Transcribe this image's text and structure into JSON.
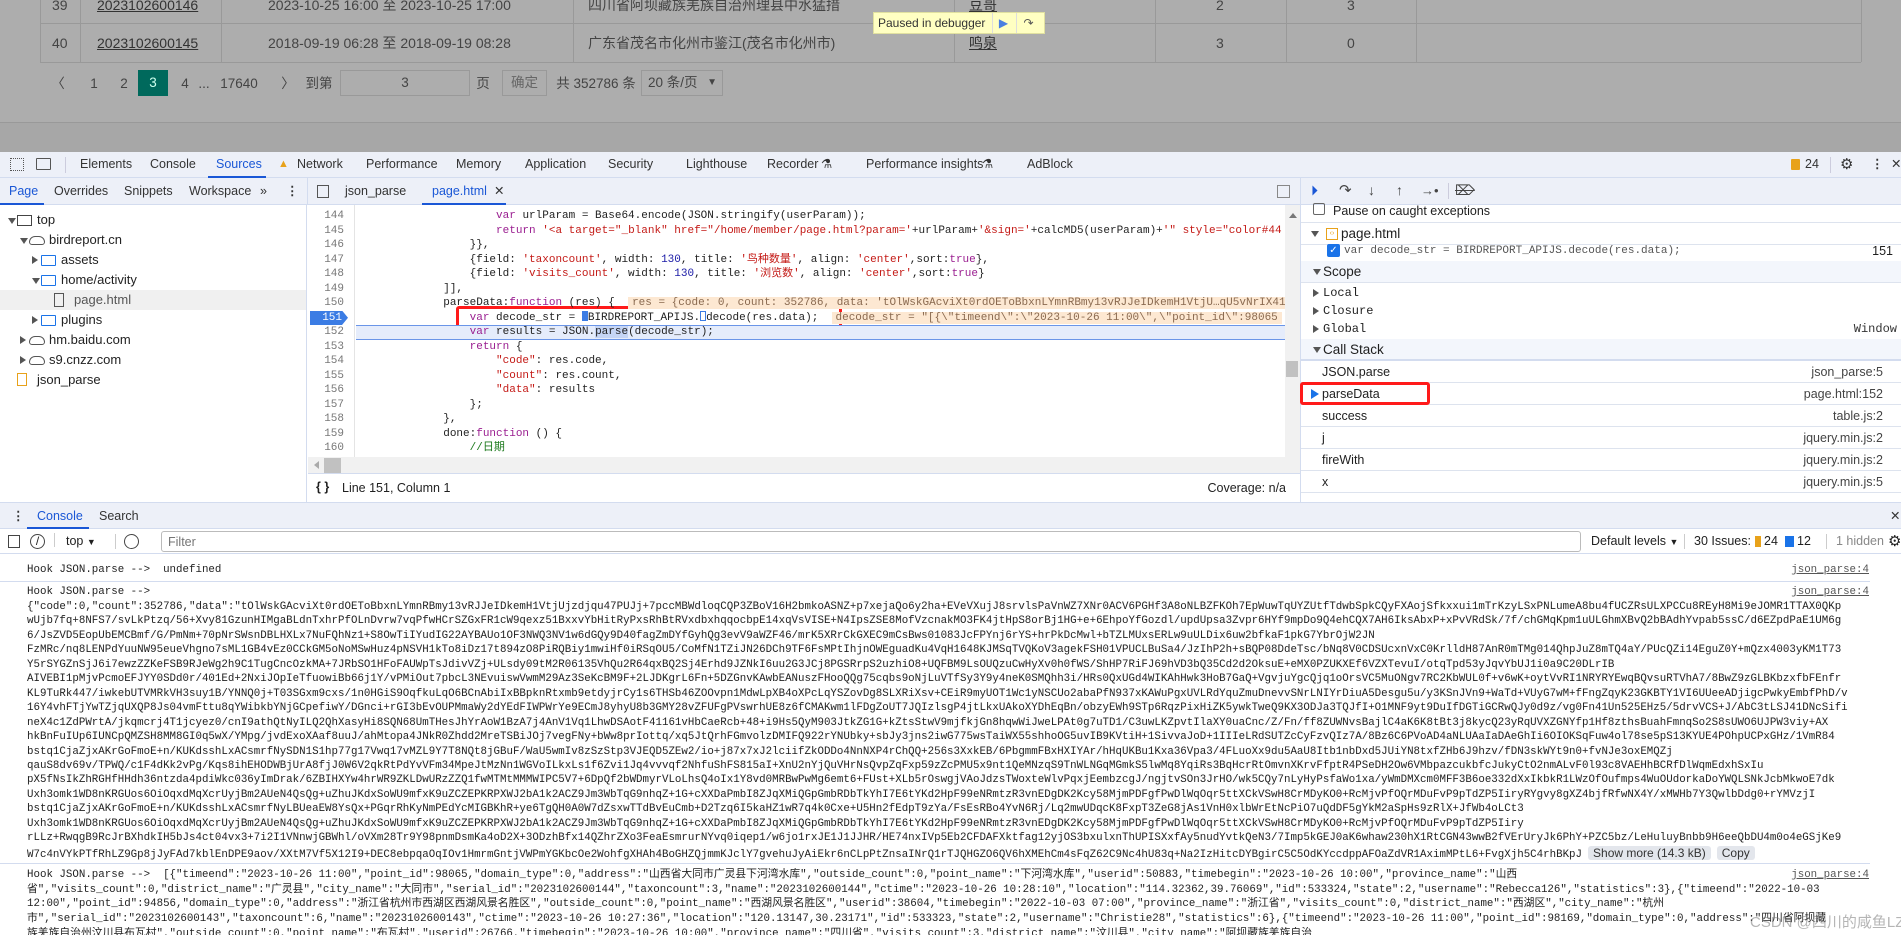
{
  "page": {
    "rows": [
      {
        "index": "39",
        "serial": "2023102600146",
        "time": "2023-10-25 16:00 至 2023-10-25 17:00",
        "address": "四川省阿坝藏族羌族自治州理县中水猛措",
        "user": "豆哥",
        "taxon": "2",
        "visits": "3"
      },
      {
        "index": "40",
        "serial": "2023102600145",
        "time": "2018-09-19 06:28 至 2018-09-19 08:28",
        "address": "广东省茂名市化州市鉴江(茂名市化州市)",
        "user": "鸣泉",
        "taxon": "3",
        "visits": "0"
      }
    ],
    "pager": {
      "prev": "〈",
      "pages": [
        "1",
        "2",
        "3",
        "4"
      ],
      "active": "3",
      "ellipsis": "...",
      "last": "17640",
      "next": "〉",
      "goto_label": "到第",
      "goto_value": "3",
      "page_unit": "页",
      "confirm": "确定",
      "total": "共 352786 条",
      "page_size": "20 条/页",
      "accent": "#00695c"
    },
    "paused_label": "Paused in debugger"
  },
  "devtools": {
    "tabs": [
      "Elements",
      "Console",
      "Sources",
      "Network",
      "Performance",
      "Memory",
      "Application",
      "Security",
      "Lighthouse",
      "Recorder",
      "Performance insights",
      "AdBlock"
    ],
    "active_tab": "Sources",
    "issues_count": "24",
    "sources_subtabs": [
      "Page",
      "Overrides",
      "Snippets",
      "Workspace"
    ],
    "editor_tabs": [
      "json_parse",
      "page.html"
    ],
    "navigator": [
      {
        "label": "top",
        "icon": "frame-icon",
        "level": 0,
        "expanded": true
      },
      {
        "label": "birdreport.cn",
        "icon": "cloud-icon",
        "level": 1,
        "expanded": true
      },
      {
        "label": "assets",
        "icon": "folder-icon",
        "level": 2,
        "expanded": false
      },
      {
        "label": "home/activity",
        "icon": "folder-icon",
        "level": 2,
        "expanded": true
      },
      {
        "label": "page.html",
        "icon": "file-icon",
        "level": 3,
        "selected": true
      },
      {
        "label": "plugins",
        "icon": "folder-icon",
        "level": 2,
        "expanded": false
      },
      {
        "label": "hm.baidu.com",
        "icon": "cloud-icon",
        "level": 1,
        "expanded": false
      },
      {
        "label": "s9.cnzz.com",
        "icon": "cloud-icon",
        "level": 1,
        "expanded": false
      },
      {
        "label": "json_parse",
        "icon": "snippet-icon",
        "level": 0
      }
    ],
    "code": {
      "current_line": "152",
      "breakpoint_line": "151",
      "lines": [
        {
          "n": "144",
          "tokens": [
            [
              "                    ",
              "plain"
            ],
            [
              "var",
              "kw"
            ],
            [
              " urlParam = Base64.encode(JSON.stringify(userParam));",
              "plain"
            ]
          ]
        },
        {
          "n": "145",
          "tokens": [
            [
              "                    ",
              "plain"
            ],
            [
              "return",
              "kw"
            ],
            [
              " ",
              "plain"
            ],
            [
              "'<a target=\"_blank\" href=\"/home/member/page.html?param='",
              "str"
            ],
            [
              "+urlParam+",
              "plain"
            ],
            [
              "'&sign='",
              "str"
            ],
            [
              "+calcMD5(userParam)+",
              "plain"
            ],
            [
              "'\" style=\"color#44",
              "str"
            ]
          ]
        },
        {
          "n": "146",
          "tokens": [
            [
              "                }},",
              "plain"
            ]
          ]
        },
        {
          "n": "147",
          "tokens": [
            [
              "                {field: ",
              "plain"
            ],
            [
              "'taxoncount'",
              "str"
            ],
            [
              ", width: ",
              "plain"
            ],
            [
              "130",
              "num"
            ],
            [
              ", title: ",
              "plain"
            ],
            [
              "'鸟种数量'",
              "str"
            ],
            [
              ", align: ",
              "plain"
            ],
            [
              "'center'",
              "str"
            ],
            [
              ",sort:",
              "plain"
            ],
            [
              "true",
              "kw"
            ],
            [
              "},",
              "plain"
            ]
          ]
        },
        {
          "n": "148",
          "tokens": [
            [
              "                {field: ",
              "plain"
            ],
            [
              "'visits_count'",
              "str"
            ],
            [
              ", width: ",
              "plain"
            ],
            [
              "130",
              "num"
            ],
            [
              ", title: ",
              "plain"
            ],
            [
              "'浏览数'",
              "str"
            ],
            [
              ", align: ",
              "plain"
            ],
            [
              "'center'",
              "str"
            ],
            [
              ",sort:",
              "plain"
            ],
            [
              "true",
              "kw"
            ],
            [
              "}",
              "plain"
            ]
          ]
        },
        {
          "n": "149",
          "tokens": [
            [
              "            ]],",
              "plain"
            ]
          ]
        },
        {
          "n": "150",
          "tokens": [
            [
              "            parseData:",
              "plain"
            ],
            [
              "function",
              "kw"
            ],
            [
              " (res) {  ",
              "plain"
            ]
          ],
          "inline": "res = {code: 0, count: 352786, data: 'tOlWskGAcviXt0rdOEToBbxnLYmnRBmy13vRJJeIDkemH1VtjU…qU5vNrIX41"
        },
        {
          "n": "151",
          "tokens": [
            [
              "                ",
              "plain"
            ],
            [
              "var",
              "kw"
            ],
            [
              " decode_str = ",
              "plain"
            ],
            [
              "▶",
              "plain"
            ],
            [
              "BIRDREPORT_APIJS.",
              "plain"
            ],
            [
              "▷",
              "plain"
            ],
            [
              "decode(res.data);  ",
              "plain"
            ]
          ],
          "inline": "decode_str = \"[{\\\"timeend\\\":\\\"2023-10-26 11:00\\\",\\\"point_id\\\":98065"
        },
        {
          "n": "152",
          "tokens": [
            [
              "                ",
              "plain"
            ],
            [
              "var",
              "kw"
            ],
            [
              " results = JSON.",
              "plain"
            ],
            [
              "parse",
              "plain"
            ],
            [
              "(decode_str);",
              "plain"
            ]
          ]
        },
        {
          "n": "153",
          "tokens": [
            [
              "                ",
              "plain"
            ],
            [
              "return",
              "kw"
            ],
            [
              " {",
              "plain"
            ]
          ]
        },
        {
          "n": "154",
          "tokens": [
            [
              "                    ",
              "plain"
            ],
            [
              "\"code\"",
              "str"
            ],
            [
              ": res.code,",
              "plain"
            ]
          ]
        },
        {
          "n": "155",
          "tokens": [
            [
              "                    ",
              "plain"
            ],
            [
              "\"count\"",
              "str"
            ],
            [
              ": res.count,",
              "plain"
            ]
          ]
        },
        {
          "n": "156",
          "tokens": [
            [
              "                    ",
              "plain"
            ],
            [
              "\"data\"",
              "str"
            ],
            [
              ": results",
              "plain"
            ]
          ]
        },
        {
          "n": "157",
          "tokens": [
            [
              "                };",
              "plain"
            ]
          ]
        },
        {
          "n": "158",
          "tokens": [
            [
              "            },",
              "plain"
            ]
          ]
        },
        {
          "n": "159",
          "tokens": [
            [
              "            done:",
              "plain"
            ],
            [
              "function",
              "kw"
            ],
            [
              " () {",
              "plain"
            ]
          ]
        },
        {
          "n": "160",
          "tokens": [
            [
              "                ",
              "plain"
            ],
            [
              "//日期",
              "cmt"
            ]
          ]
        }
      ]
    },
    "status": {
      "position": "Line 151, Column 1",
      "coverage": "Coverage: n/a"
    },
    "debugger": {
      "pause_caught": "Pause on caught exceptions",
      "bp_file": "page.html",
      "bp_code": "var decode_str = BIRDREPORT_APIJS.decode(res.data);",
      "bp_line": "151",
      "scope_label": "Scope",
      "scope": [
        "Local",
        "Closure",
        "Global"
      ],
      "global_value": "Window",
      "callstack_label": "Call Stack",
      "callstack": [
        {
          "fn": "JSON.parse",
          "loc": "json_parse:5"
        },
        {
          "fn": "parseData",
          "loc": "page.html:152",
          "current": true
        },
        {
          "fn": "success",
          "loc": "table.js:2"
        },
        {
          "fn": "j",
          "loc": "jquery.min.js:2"
        },
        {
          "fn": "fireWith",
          "loc": "jquery.min.js:2"
        },
        {
          "fn": "x",
          "loc": "jquery.min.js:5"
        }
      ]
    },
    "drawer_tabs": [
      "Console",
      "Search"
    ],
    "console": {
      "context": "top",
      "filter_placeholder": "Filter",
      "levels": "Default levels",
      "issues_label": "30 Issues:",
      "issues_warn": "24",
      "issues_info": "12",
      "hidden": "1 hidden",
      "messages": [
        {
          "text": "Hook JSON.parse -->  undefined",
          "source": "json_parse:4"
        },
        {
          "text": "Hook JSON.parse -->",
          "source": "json_parse:4"
        }
      ],
      "blob_lines": [
        "{\"code\":0,\"count\":352786,\"data\":\"tOlWskGAcviXt0rdOEToBbxnLYmnRBmy13vRJJeIDkemH1VtjUjzdjqu47PUJj+7pccMBWdloqCQP3ZBoV16H2bmkoASNZ+p7xejaQo6y2ha+EVeVXujJ8srvlsPaVnWZ7XNr0ACV6PGHf3A8oNLBZFKOh7EpWuwTqUYZUtfTdwbSpkCQyFXAojSfkxxui1mTrKzyLSxPNLumeA8bu4fUCZRsULXPCCu8REyH8Mi9eJOMR1TTAX0QKp",
        "wUjb7fq+8NFS7/svLkPtzq/56+Xvy81GzunHIMgaBLdnTxhrPfOLnDvrw7vqPfwHCrSZGxFR1cW9qexz51BxxvYbHitRyPxsRhBtRVxdbxhqqocbpE14xqVsVISE+N4IpsZSE8MofVzcnakMO3FK4jtHpS8orBj1HG+e+6EhpoYfGozdl/updUpsa3Zvpr6HYf9mpDo9Q4ehCQX7AH6IksAbxP+xPvVRdSk/7f/chGMqKpm1uULGhmXBvQ2bBAdhYvpab5ssC/d6EZpdPaE1UM6g",
        "6/JsZVD5EopUbEMCBmf/G/PmNm+70pNrSWsnDBLHXLx7NuFQhNz1+S8OwTiIYudIG22AYBAUo1OF3NWQ3NV1w6dGQy9D40fagZmDYfGyhQg3evV9aWZF46/mrK5XRrCkGXEC9mCsBws01083JcFPYnj6rYS+hrPkDcMwl+bTZLMUxsERLw9uULDix6uw2bfkaF1pkG7YbrOjW2JN",
        "FzMRc/nq8LENPdYuuNW95eueVhgno7sML1GB4vEz0CCkGM5oNoMSwHuz4pNSVH1kTo8iDz17t894zO8PiRQBiy1mwiHf0iRSqOU5/CoMfN1TZiJN26DCh9TF6FsMPtIhjnOWEguadKu4VqH1648KJMSqTVQKoV3agekFSH01VPUCLBuSa4/JzIhP2h+sBQP08DdeTsc/bNq8V0CDSUcxnVxC0KrlldH87AnR0mTMg014QhpJuZ8mTQ4aY/PUcQZi14EguZ0Y+mQzx4003yKM1T73",
        "Y5rSYGZnSjJ6i7ewzZZKeFSB9RJeWg2h9C1TugCncOzkMA+7JRbSO1HFoFAUWpTsJdivVZj+ULsdy09tM2R06135VhQu2R64qxBQ2Sj4Erhd9JZNkI6uu2G3JCj8PGSRrpS2uzhiO8+UQFBM9LsOUQzuCwHyXv0h0fWS/ShHP7RiFJ69hVD3bQ35Cd2d2OksuE+eMX0PZUKXEf6VZXTevuI/otqTpd53yJqvYbUJ1i0a9C20DLrIB",
        "AIVEBI1pMjvPcmoEFJYY0SDd0r/401Ed+2NxiJOpIeTfuowiBb66j1Y/vPMiOut7pbcL3NEvuiswVwmM29Az3SeKcBM9F+2LJDKgrL6Fn+5DZGnvKAwbEANuszFHooQQg75cqbs9oNjLuVTfSy3Y9y4neK0SMQhh3i/HRs0QxUGd4WIKAhHwk3HoB7GaQ+VgvjuYgcQjq1oOrsVC5MuONgv7RC2KbWUL0f+v6wK+oytVvRI1NRYRYEwqBQvsuRTVhA7/8BwZ9zGLBKbzxfbFEnfr",
        "KL9TuRk447/iwkebUTVMRkVH3suy1B/YNNQ0j+T03SGxm9cxs/1n0HGiS9OqfkuLqO6BCnAbiIxBBpknRtxmb9etdyjrCy1s6THSb46ZOOvpn1MdwLpXB4oXPcLqYSZovDg8SLXRiXsv+CEiR9myUOT1Wc1yNSCUo2abaPfN937xKAWuPgxUVLRdYquZmuDnevvSNrLNIYrDiuA5Desgu5u/y3KSnJVn9+WaTd+VUyG7wM+fFngZqyK23GKBTY1VI6UUeeADjigcPwkyEmbfPhD/v",
        "16Y4vhFTjYwTZjqUXQP8Js04vmFttu8qYWibkbYNjGCpefiwY/DGnci+rGI3bEvOUPMmaWy2dYEdFIWPWrYe9ECmJ8yhyU8b3GMY28vZFUFgPVswrhUE8z6fCMAKwm1lFDgZoUT7JQIzlsgP4jtLkxUAkoXYDhEqBn/obzyEWh9STp6RqzPixHiZK5ywkTweQ9KX3ODJa3TQJfI+O1MNF9yt9DuIfDGTiGCRwQJy0d9z/vg0Fn41Un525EHz5/5drvVCS+J/AbC3tLSJ41DNcSifi",
        "neX4c1ZdPWrtA/jkqmcrj4T1jcyez0/cnI9athQtNyILQ2QhXasyHi8SQN68UmTHesJhYrAoW1BzA7j4AnV1Vq1LhwDSAotF41161vHbCaeRcb+48+i9Hs5QyM903JtkZG1G+kZtsStwV9mjfkjGn8hqwWiJweLPAt0g7uTD1/C3uwLKZpvtIlaXY0uaCnc/Z/Fn/ff8ZUWNvsBajlC4aK6K8tBt3j8kycQ23yRqUVXZGNYfp1Hf8zthsBuahFmnqSo2S8sUWO6UJPW3viy+AX",
        "hkBnFuIUp6IUNCpQMZSH8MM8GI0q5wX/YMpg/jvdExoXAaf8uuJ/ahMtopa4JNkR0Zhdd2MreTSBiJOj7vegFNy+bWw8prIottq/xq5JtQrhFGmvolzDMIFQ922rYNUbky+sbJy3jns2iwG775wsTaiWX55shhoOG5uvIB9KVtiH+1SivvaJoD+1IIIeLRdSUTZcCyFzvQIz7A/8Bz6C6PVoAD4aNLUAaIaDAeGhIi6OIOKSqFuw4ol78se5pS13KYUE4POhpUCPxGHz/1VmR84",
        "bstq1CjaZjxAKrGoFmoE+n/KUKdsshLxACsmrfNySDN1S1hp77g17Vwq17vMZL9Y7T8NQt8jGBuF/WaU5wmIv8zSzStp3VJEQD5ZEw2/io+j87x7xJ2lciifZkODDo4NnNXP4rChQQ+256s3XxkEB/6PbgmmFBxHXIYAr/hHqUKBu1Kxa36Vpa3/4FLuoXx9du5AaU8Itb1nbDxd5JUiYN8txfZHb6J9hzv/fDN3skWYt9n0+fvNJe3oxEMQZj",
        "qauS8dv69v/TPWQ/c1F4dKk2vPg/Kqs8ihEHODWBjUrA8fjJ0W6V2qkRtPdYvVFm34MpeJtMzNn1WGVoILkxLs1f6Zvi1Jq4vvvqf2NhfuShFS815aI+XnU2nYjQuVHrNsQvpZqFxp59zZcPMU5x9nt1QeMNzqS9TnWLNGqMGmkS5lwMq8YqiRs3BqHcrRtOmvnXKrvFfptR4PSeDH2Ow6VMbpazcukbfcJukyCtO2nmALvF0l93c8VAEHhBCRfDlWqmEdxhSxIu",
        "pX5fNsIkZhRGHfHHdh36ntzda4pdiWkc036yImDrak/6ZBIHXYw4hrWR9ZKLDwURzZZQ1fwMTMtMMMWIPC5V7+6DpQf2bWDmyrVLoLhsQ4oIx1Y8vd0MRBwPwMg6emt6+FUst+XLb5rOswgjVAoJdzsTWoxteWlvPqxjEembzcgJ/ngjtvSOn3JrHO/wk5CQy7nLyHyPsfaWo1xa/yWmDMXcm0MFF3B6oe332dXxIkbkR1LWzOfOufmps4WuOUdorkaDoYWQLSNkJcbMkwoE7dk",
        "Uxh3omk1WD8nKRGUos6OiOqxdMqXcrUyjBm2AUeN4QsQg+uZhuJKdxSoWU9mfxK9uZCZEPKRPXWJ2bA1k2ACZ9Jm3WbTqG9nhqZ+1G+cXXDaPmbI8ZJqXMiQGpGmbRDbTkYhI7E6tYKd2HpF99eNRmtzR3vnEDgDK2Kcy58MjmPDFgfPwDlWqOqr5ttXCkVSwH8CrMDyKO0+RcMjvPfOQrMDuFvP9pTdZP5IiryRYgvy8gXZ4bjfRfwNX4Y/xMWHb7Y3QwlbDdg0+rYMVzjI",
        "bstq1CjaZjxAKrGoFmoE+n/KUKdsshLxACsmrfNyLBUeaEW8YsQx+PGqrRhKyNmPEdYcMIGBKhR+ye6TgQH0A0W7dZsxwTTdBvEuCmb+D2Tzq6I5kaHZ1wR7q4k0Cxe+U5Hn2fEdpT9zYa/FsEsRBo4YvN6Rj/Lq2mwUDqcK8FxpT3ZeG8jAs1VnH0xlbWrEtNcPiO7uQdDF5gYkM2aSpHs9zRlX+JfWb4oLCt3",
        "Uxh3omk1WD8nKRGUos6OiOqxdMqXcrUyjBm2AUeN4QsQg+uZhuJKdxSoWU9mfxK9uZCZEPKRPXWJ2bA1k2ACZ9Jm3WbTqG9nhqZ+1G+cXXDaPmbI8ZJqXMiQGpGmbRDbTkYhI7E6tYKd2HpF99eNRmtzR3vnEDgDK2Kcy58MjmPDFgfPwDlWqOqr5ttXCkVSwH8CrMDyKO0+RcMjvPfOQrMDuFvP9pTdZP5Iiry",
        "rLLz+RwqgB9RcJrBXhdkIH5bJs4ct04vx3+7i2I1VNnwjGBWhl/oVXm28Tr9Y98pnmDsmKa4oD2X+3ODzhBfx14QZhrZXo3FeaEsmrurNYvq0iqep1/w6jo1rxJE1J1JJHR/HE74nxIVp5Eb2CFDAFXktfag12yjOS3bxulxnThUPISXxfAy5nudYvtkQeN3/7Imp5kGEJ0aK6whaw230hX1RtCGN43wwB2fVErUryJk6PhY+PZC5bz/LeHuluyBnbb9H6eeQbDU4m0o4eGSjKe9",
        "W7c4nVYkPTfRhLZ9Gp8jJyFAd7kblEnDPE9aov/XXtM7Vf5X12I9+DEC8ebpqaOqIOv1HmrmGntjVWPmYGKbcOe2WohfgXHAh4BoGHZQjmmKJclY7gvehuJyAiEkr6nCLpPtZnsaINrQ1rTJQHGZO6QV6hXMEhCm4sFqZ62C9Nc4hU83q+Na2IzHitcDYBgirC5C5OdKYccdppAFOaZdVR1AximMPtL6+FvgXjh5C4rhBKpJ"
      ],
      "show_more": "Show more (14.3 kB)",
      "copy": "Copy",
      "hook3_source": "json_parse:4",
      "hook3_lines": [
        "Hook JSON.parse -->  [{\"timeend\":\"2023-10-26 11:00\",\"point_id\":98065,\"domain_type\":0,\"address\":\"山西省大同市广灵县下河湾水库\",\"outside_count\":0,\"point_name\":\"下河湾水库\",\"userid\":50883,\"timebegin\":\"2023-10-26 10:00\",\"province_name\":\"山西",
        "省\",\"visits_count\":0,\"district_name\":\"广灵县\",\"city_name\":\"大同市\",\"serial_id\":\"2023102600144\",\"taxoncount\":3,\"name\":\"2023102600144\",\"ctime\":\"2023-10-26 10:28:10\",\"location\":\"114.32362,39.76069\",\"id\":533324,\"state\":2,\"username\":\"Rebecca126\",\"statistics\":3},{\"timeend\":\"2022-10-03",
        "12:00\",\"point_id\":94856,\"domain_type\":0,\"address\":\"浙江省杭州市西湖区西湖风景名胜区\",\"outside_count\":0,\"point_name\":\"西湖风景名胜区\",\"userid\":38604,\"timebegin\":\"2022-10-03 07:00\",\"province_name\":\"浙江省\",\"visits_count\":0,\"district_name\":\"西湖区\",\"city_name\":\"杭州",
        "市\",\"serial_id\":\"2023102600143\",\"taxoncount\":6,\"name\":\"2023102600143\",\"ctime\":\"2023-10-26 10:27:36\",\"location\":\"120.13147,30.23171\",\"id\":533323,\"state\":2,\"username\":\"Christie28\",\"statistics\":6},{\"timeend\":\"2023-10-26 11:00\",\"point_id\":98169,\"domain_type\":0,\"address\":\"四川省阿坝藏",
        "族羌族自治州汶川县布瓦村\",\"outside_count\":0,\"point_name\":\"布瓦村\",\"userid\":26766,\"timebegin\":\"2023-10-26 10:00\",\"province_name\":\"四川省\",\"visits_count\":3,\"district_name\":\"汶川县\",\"city_name\":\"阿坝藏族羌族自治"
      ]
    }
  },
  "watermark": "CSDN @四川的咸鱼LZ"
}
